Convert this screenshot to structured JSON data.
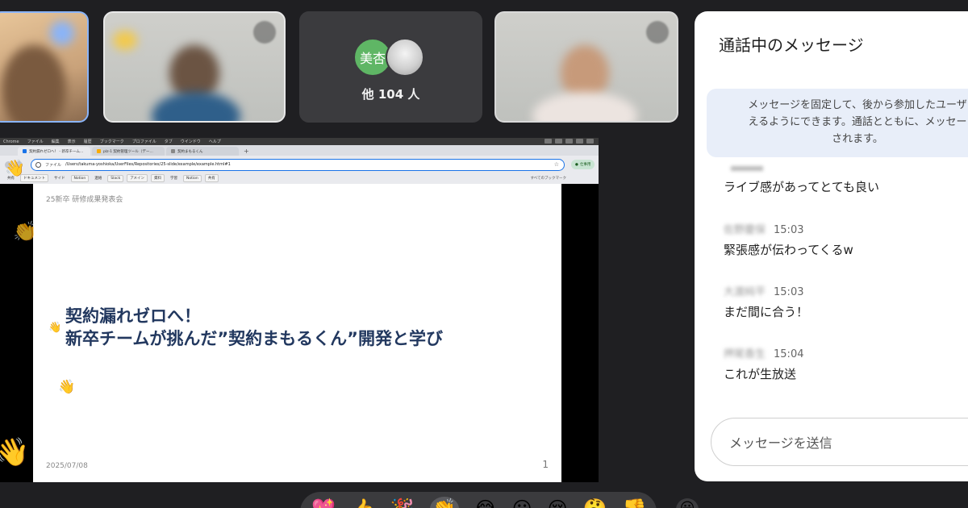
{
  "participants": {
    "others_label": "他 104 人",
    "avatar_initials": "美杏"
  },
  "screen": {
    "menubar": [
      "Chrome",
      "ファイル",
      "編集",
      "表示",
      "履歴",
      "ブックマーク",
      "プロファイル",
      "タブ",
      "ウインドウ",
      "ヘルプ"
    ],
    "tabs": [
      "契約漏れゼロへ！ - 新卒チーム…",
      "plz-1 契約管理ツール（デー…",
      "契約まもるくん"
    ],
    "address": {
      "scheme": "ファイル",
      "url": "/Users/takuma-yoshioka/UserFiles/Repositories/25-slide/example/example.html#1"
    },
    "profile_label": "仕事用",
    "bookmarks": [
      "共有",
      "ドキュメント",
      "サイド",
      "Notion",
      "連絡",
      "Slack",
      "アメイン",
      "資料",
      "学習",
      "Notion",
      "共有"
    ],
    "bookmarks_right": "すべてのブックマーク"
  },
  "slide": {
    "header": "25新卒 研修成果発表会",
    "title_line1": "契約漏れゼロへ！",
    "title_line2": "新卒チームが挑んだ”契約まもるくん”開発と学び",
    "date": "2025/07/08",
    "page": "1"
  },
  "chat": {
    "title": "通話中のメッセージ",
    "pin_info": [
      "メッセージを固定して、後から参加したユーザ",
      "えるようにできます。通話とともに、メッセー",
      "されます。"
    ],
    "messages": [
      {
        "name": "",
        "time": "",
        "text": "ライブ感があってとても良い"
      },
      {
        "name": "佐野慶保",
        "time": "15:03",
        "text": "緊張感が伝わってくるw"
      },
      {
        "name": "大渡純平",
        "time": "15:03",
        "text": "まだ間に合う！"
      },
      {
        "name": "押尾香生",
        "time": "15:04",
        "text": "これが生放送"
      }
    ],
    "input_placeholder": "メッセージを送信"
  },
  "reactions": {
    "bar": [
      "💖",
      "👍",
      "🎉",
      "👏",
      "😂",
      "😮",
      "😢",
      "🤔",
      "👎"
    ],
    "extra": "😀",
    "floating": [
      "👋",
      "👏",
      "👋",
      "👋",
      "👋"
    ]
  }
}
